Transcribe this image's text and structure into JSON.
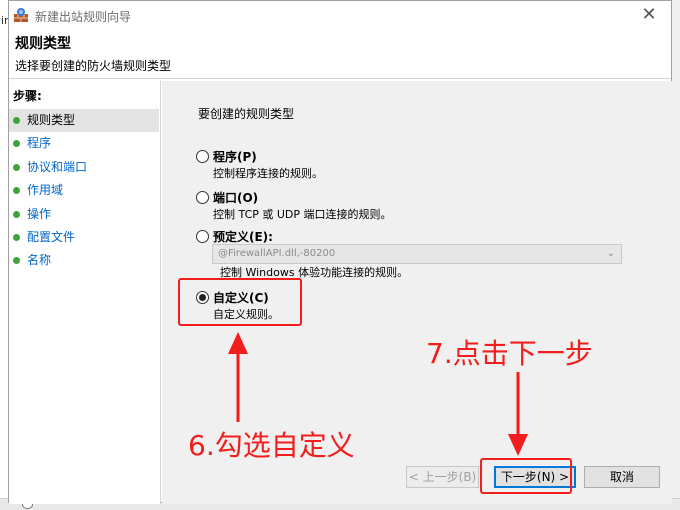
{
  "background": {
    "left_fragment": "in"
  },
  "window": {
    "title": "新建出站规则向导",
    "close_glyph": "✕"
  },
  "header": {
    "title": "规则类型",
    "subtitle": "选择要创建的防火墙规则类型"
  },
  "steps": {
    "label": "步骤:",
    "items": [
      {
        "label": "规则类型",
        "active": true
      },
      {
        "label": "程序",
        "active": false
      },
      {
        "label": "协议和端口",
        "active": false
      },
      {
        "label": "作用域",
        "active": false
      },
      {
        "label": "操作",
        "active": false
      },
      {
        "label": "配置文件",
        "active": false
      },
      {
        "label": "名称",
        "active": false
      }
    ]
  },
  "content": {
    "question": "要创建的规则类型",
    "options": [
      {
        "label": "程序(P)",
        "description": "控制程序连接的规则。",
        "checked": false
      },
      {
        "label": "端口(O)",
        "description": "控制 TCP 或 UDP 端口连接的规则。",
        "checked": false
      },
      {
        "label": "预定义(E):",
        "description": "控制 Windows 体验功能连接的规则。",
        "checked": false
      },
      {
        "label": "自定义(C)",
        "description": "自定义规则。",
        "checked": true
      }
    ],
    "predefined_select": {
      "value": "@FirewallAPI.dll,-80200",
      "enabled": false
    }
  },
  "buttons": {
    "back": "< 上一步(B)",
    "next": "下一步(N) >",
    "cancel": "取消"
  },
  "annotations": {
    "step6": "6.勾选自定义",
    "step7": "7.点击下一步"
  },
  "colors": {
    "annotation_red": "#f21d1d",
    "link_blue": "#0066cc",
    "step_dot_green": "#3da43a",
    "default_button_border": "#0078d7"
  },
  "icons": {
    "title_icon": "firewall-wall-icon",
    "close": "close-icon",
    "step_marker": "green-dot-icon",
    "dropdown": "chevron-down-icon"
  }
}
